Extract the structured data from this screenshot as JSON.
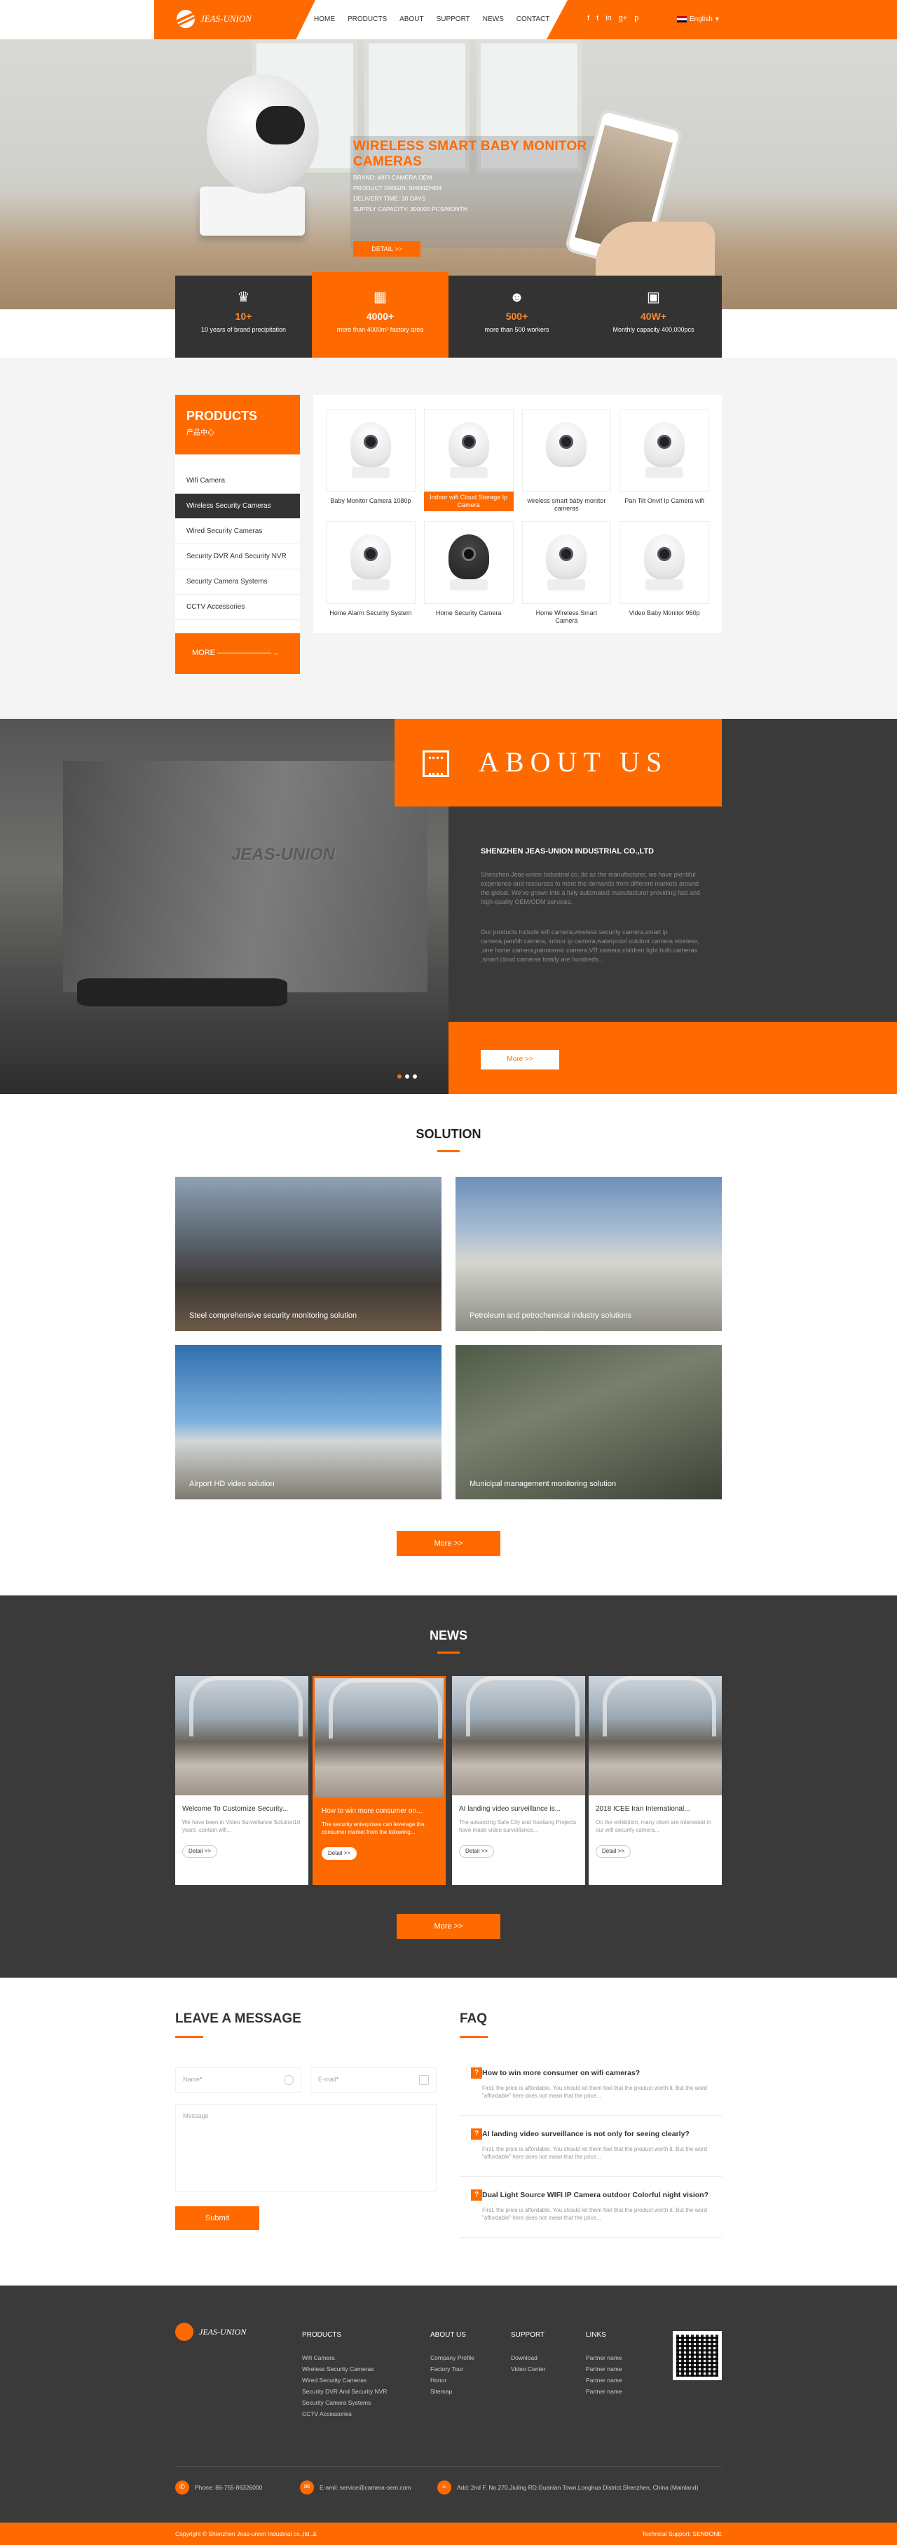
{
  "header": {
    "logo_text": "JEAS-UNION",
    "nav": [
      "HOME",
      "PRODUCTS",
      "ABOUT",
      "SUPPORT",
      "NEWS",
      "CONTACT"
    ],
    "social_icons": [
      "facebook-icon",
      "twitter-icon",
      "linkedin-icon",
      "google-plus-icon",
      "pinterest-icon"
    ],
    "language": "English"
  },
  "hero": {
    "title": "WIRELESS SMART BABY MONITOR CAMERAS",
    "specs": [
      "BRAND:  WIFI CAMERA OEM",
      "PRODUCT ORIGIN:  SHENZHEN",
      "DELIVERY TIME:  30 DAYS",
      "SUPPLY CAPACITY:  300000 PCS/MONTH"
    ],
    "button": "DETAIL >>"
  },
  "stats": [
    {
      "icon": "crown-icon",
      "num": "10+",
      "label": "10 years of brand precipitation"
    },
    {
      "icon": "factory-icon",
      "num": "4000+",
      "label": "more than 4000m² factory area"
    },
    {
      "icon": "worker-icon",
      "num": "500+",
      "label": "more than 500 workers"
    },
    {
      "icon": "monitor-icon",
      "num": "40W+",
      "label": "Monthly capacity 400,000pcs"
    }
  ],
  "products": {
    "title": "PRODUCTS",
    "subtitle": "产品中心",
    "categories": [
      "Wifi Camera",
      "Wireless Security Cameras",
      "Wired Security Cameras",
      "Security DVR And Security NVR",
      "Security Camera Systems",
      "CCTV Accessories"
    ],
    "more": "MORE",
    "items": [
      "Baby Monitor Camera 1080p",
      "Indoor wifi Cloud Storage Ip Camera",
      "wireless smart baby monitor cameras",
      "Pan Tilt Onvif Ip Camera wifi",
      "Home Alarm Security System",
      "Home Security Camera",
      "Home Wireless Smart Camera",
      "Video Baby Monitor 960p"
    ]
  },
  "about": {
    "title": "ABOUT US",
    "company": "SHENZHEN JEAS-UNION INDUSTRIAL CO.,LTD",
    "p1": "Shenzhen Jeas-union Industrial co.,ltd as the manufacturer, we have plentiful experience and resources to meet the demands from different markets around the global. We’ve grown into a fully automated manufacturer providing fast and high-quality OEM/ODM services.",
    "p2": "Our products include wifi camera,wireless security camera,smart ip camera,pan/tilt camera, indoor ip camera,waterproof outdoor camera wireless, ,one home camera,panoramic camera,VR camera,children light bulb cameras ,smart cloud cameras totally are hundreds...",
    "more": "More >>",
    "wall_logo": "JEAS-UNION"
  },
  "solution": {
    "title": "SOLUTION",
    "items": [
      "Steel comprehensive security monitoring solution",
      "Petroleum and petrochemical industry solutions",
      "Airport HD video solution",
      "Municipal management monitoring solution"
    ],
    "more": "More >>"
  },
  "news": {
    "title": "NEWS",
    "items": [
      {
        "title": "Welcome To Customize Security...",
        "desc": "We have been in Video Surveillance Solution10 years ,contain wifi...",
        "btn": "Detail >>"
      },
      {
        "title": "How to win more consumer on...",
        "desc": "The security enterprises can leverage the consumer market from the following...",
        "btn": "Detail >>"
      },
      {
        "title": "AI landing video surveillance is...",
        "desc": "The advancing Safe City and Xueliang Projects have made video surveillance...",
        "btn": "Detail >>"
      },
      {
        "title": "2018 ICEE Iran International...",
        "desc": "On the exhibition, many client are interested in our wifi security camera...",
        "btn": "Detail >>"
      }
    ],
    "more": "More >>"
  },
  "message": {
    "title": "LEAVE A MESSAGE",
    "name_placeholder": "Name",
    "email_placeholder": "E-mail",
    "message_placeholder": "Message",
    "submit": "Submit"
  },
  "faq": {
    "title": "FAQ",
    "items": [
      {
        "q": "How to win more consumer on wifi cameras?",
        "a": "First, the price is affordable. You should let them feel that the product worth it. But the word \"affordable\" here does not mean that the price..."
      },
      {
        "q": "AI landing video surveillance is not only for seeing clearly?",
        "a": "First, the price is affordable. You should let them feel that the product worth it. But the word \"affordable\" here does not mean that the price..."
      },
      {
        "q": "Dual Light Source WIFI IP Camera outdoor Colorful night vision?",
        "a": "First, the price is affordable. You should let them feel that the product worth it. But the word \"affordable\" here does not mean that the price..."
      }
    ]
  },
  "footer": {
    "logo_text": "JEAS-UNION",
    "products_title": "PRODUCTS",
    "products": [
      "Wifi Camera",
      "Wireless Security Cameras",
      "Wired Security Cameras",
      "Security DVR And Security NVR",
      "Security Camera Systems",
      "CCTV Accessories"
    ],
    "about_title": "ABOUT US",
    "about": [
      "Company Profile",
      "Factory Tour",
      "Honor",
      "Sitemap"
    ],
    "support_title": "SUPPORT",
    "support": [
      "Download",
      "Video Center"
    ],
    "links_title": "LINKS",
    "links": [
      "Partner name",
      "Partner name",
      "Partner name",
      "Partner name"
    ],
    "phone": "Phone: 86-755-86326000",
    "email": "E-amil: service@camera-oem.com",
    "address": "Add: 2nd F, No.270,Jiuling RD,Guanlan Town,Longhua District,Shenzhen, China (Mainland)",
    "copyright": "Copyright © Shenzhen Jeas-union Industrial co.,ltd.,&",
    "support_credit": "Technical Support: SENBONE"
  }
}
